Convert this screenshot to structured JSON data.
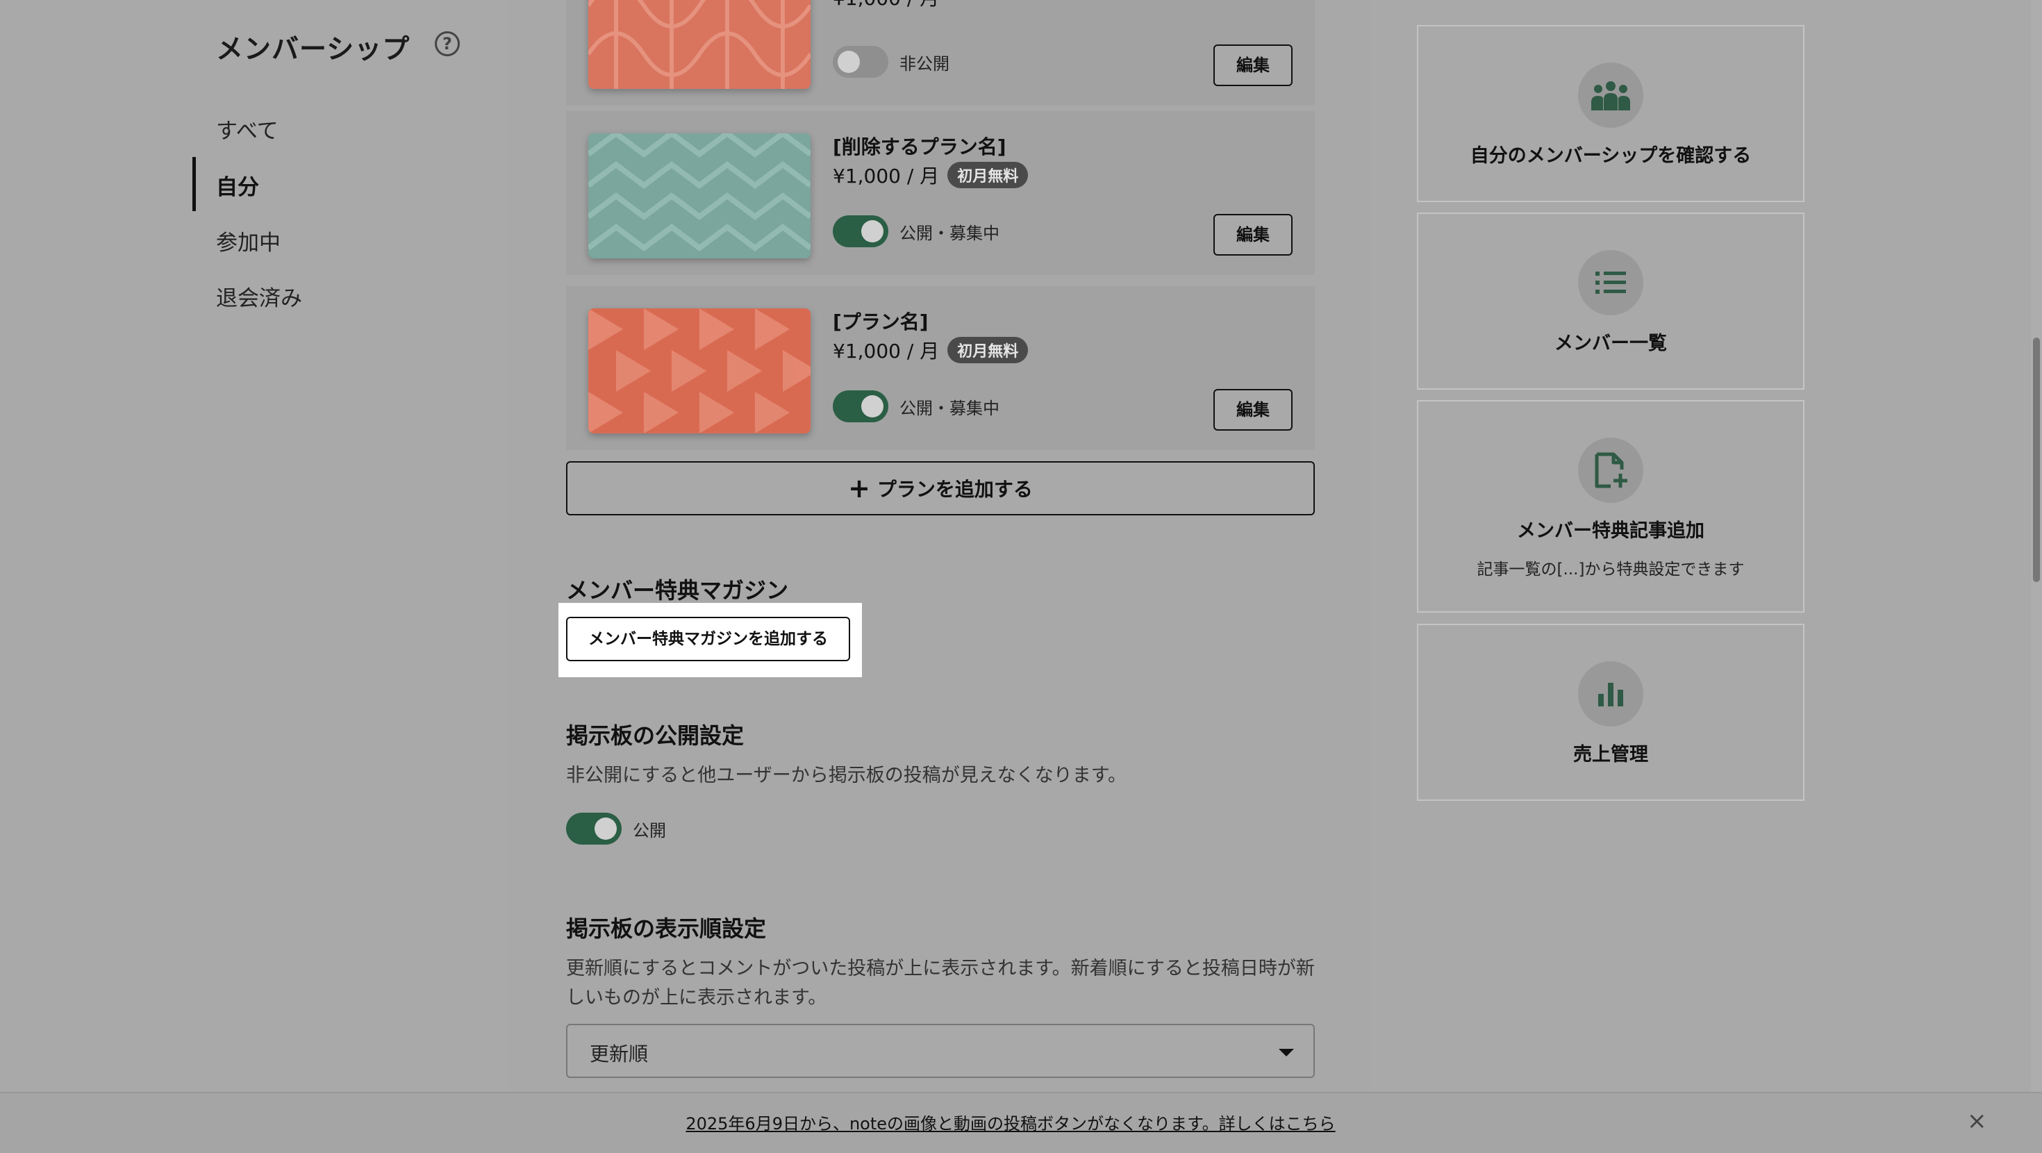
{
  "sidebar": {
    "title": "メンバーシップ",
    "help_icon": "?",
    "items": [
      {
        "label": "すべて"
      },
      {
        "label": "自分",
        "active": true
      },
      {
        "label": "参加中"
      },
      {
        "label": "退会済み"
      }
    ]
  },
  "plans": [
    {
      "name": "",
      "price": "¥1,000 / 月",
      "badge": "",
      "status": "非公開",
      "published": false,
      "edit_label": "編集",
      "image_color": "#d9745f"
    },
    {
      "name": "[削除するプラン名]",
      "price": "¥1,000 / 月",
      "badge": "初月無料",
      "status": "公開・募集中",
      "published": true,
      "edit_label": "編集",
      "image_color": "#7aa69d"
    },
    {
      "name": "[プラン名]",
      "price": "¥1,000 / 月",
      "badge": "初月無料",
      "status": "公開・募集中",
      "published": true,
      "edit_label": "編集",
      "image_color": "#d96a52"
    }
  ],
  "add_plan": {
    "icon": "+",
    "label": "プランを追加する"
  },
  "magazine": {
    "title": "メンバー特典マガジン",
    "button_label": "メンバー特典マガジンを追加する"
  },
  "board_visibility": {
    "title": "掲示板の公開設定",
    "description": "非公開にすると他ユーザーから掲示板の投稿が見えなくなります。",
    "toggle_label": "公開",
    "enabled": true
  },
  "board_order": {
    "title": "掲示板の表示順設定",
    "description": "更新順にするとコメントがついた投稿が上に表示されます。新着順にすると投稿日時が新しいものが上に表示されます。",
    "selected": "更新順"
  },
  "right_cards": [
    {
      "title": "自分のメンバーシップを確認する",
      "subtitle": "",
      "icon": "members-icon"
    },
    {
      "title": "メンバー一覧",
      "subtitle": "",
      "icon": "list-icon"
    },
    {
      "title": "メンバー特典記事追加",
      "subtitle": "記事一覧の[...]から特典設定できます",
      "icon": "file-add-icon"
    },
    {
      "title": "売上管理",
      "subtitle": "",
      "icon": "bar-chart-icon"
    }
  ],
  "notice": {
    "text": "2025年6月9日から、noteの画像と動画の投稿ボタンがなくなります。詳しくはこちら",
    "close_icon": "×"
  },
  "colors": {
    "accent": "#2a5e45",
    "icon_green": "#2f5a45"
  }
}
